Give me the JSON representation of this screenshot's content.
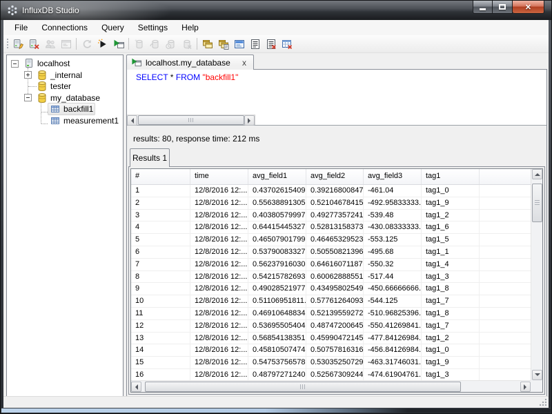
{
  "window": {
    "title": "InfluxDB Studio"
  },
  "menu": {
    "items": [
      "File",
      "Connections",
      "Query",
      "Settings",
      "Help"
    ]
  },
  "toolbar": {
    "buttons": [
      {
        "icon": "connection-edit-icon",
        "enabled": true
      },
      {
        "icon": "connection-delete-icon",
        "enabled": true
      },
      {
        "icon": "users-icon",
        "enabled": false
      },
      {
        "icon": "connection-console-icon",
        "enabled": false
      },
      {
        "sep": true
      },
      {
        "icon": "refresh-icon",
        "enabled": false
      },
      {
        "icon": "run-query-icon",
        "enabled": true
      },
      {
        "icon": "run-query-new-tab-icon",
        "enabled": true
      },
      {
        "sep": true
      },
      {
        "icon": "database-add-icon",
        "enabled": false
      },
      {
        "icon": "database-refresh-icon",
        "enabled": false
      },
      {
        "icon": "database-time-icon",
        "enabled": false
      },
      {
        "icon": "database-delete-icon",
        "enabled": false
      },
      {
        "sep": true
      },
      {
        "icon": "cascade-windows-icon",
        "enabled": true
      },
      {
        "icon": "window-query-icon",
        "enabled": true
      },
      {
        "icon": "console-icon",
        "enabled": true
      },
      {
        "icon": "list-icon",
        "enabled": true
      },
      {
        "icon": "list-delete-icon",
        "enabled": true
      },
      {
        "icon": "table-delete-icon",
        "enabled": true
      }
    ]
  },
  "tree": {
    "items": [
      {
        "label": "localhost",
        "icon": "server",
        "level": 0,
        "expander": "minus"
      },
      {
        "label": "_internal",
        "icon": "database",
        "level": 1,
        "expander": "plus"
      },
      {
        "label": "tester",
        "icon": "database",
        "level": 1,
        "expander": "none"
      },
      {
        "label": "my_database",
        "icon": "database",
        "level": 1,
        "expander": "minus"
      },
      {
        "label": "backfill1",
        "icon": "measurement",
        "level": 2,
        "expander": "none",
        "selected": true
      },
      {
        "label": "measurement1",
        "icon": "measurement",
        "level": 2,
        "expander": "none"
      }
    ]
  },
  "query_tab": {
    "label": "localhost.my_database",
    "close": "x"
  },
  "query": {
    "tokens": [
      {
        "text": "SELECT",
        "type": "keyword"
      },
      {
        "text": " * ",
        "type": "plain"
      },
      {
        "text": "FROM",
        "type": "keyword"
      },
      {
        "text": " ",
        "type": "plain"
      },
      {
        "text": "\"backfill1\"",
        "type": "string"
      }
    ]
  },
  "colors": {
    "keyword": "#0000ff",
    "string": "#ff0000",
    "plain": "#000000"
  },
  "results": {
    "summary": "results: 80, response time: 212 ms",
    "tab_label": "Results 1"
  },
  "table": {
    "columns": [
      "#",
      "time",
      "avg_field1",
      "avg_field2",
      "avg_field3",
      "tag1"
    ],
    "rows": [
      [
        "1",
        "12/8/2016 12:...",
        "0.43702615409...",
        "0.39216800847...",
        "-461.04",
        "tag1_0"
      ],
      [
        "2",
        "12/8/2016 12:...",
        "0.55638891305...",
        "0.52104678415...",
        "-492.95833333...",
        "tag1_9"
      ],
      [
        "3",
        "12/8/2016 12:...",
        "0.40380579997...",
        "0.49277357241...",
        "-539.48",
        "tag1_2"
      ],
      [
        "4",
        "12/8/2016 12:...",
        "0.64415445327...",
        "0.52813158373...",
        "-430.08333333...",
        "tag1_6"
      ],
      [
        "5",
        "12/8/2016 12:...",
        "0.46507901799...",
        "0.46465329523...",
        "-553.125",
        "tag1_5"
      ],
      [
        "6",
        "12/8/2016 12:...",
        "0.53790083327...",
        "0.50550821396...",
        "-495.68",
        "tag1_1"
      ],
      [
        "7",
        "12/8/2016 12:...",
        "0.56237916030...",
        "0.64616071187...",
        "-550.32",
        "tag1_4"
      ],
      [
        "8",
        "12/8/2016 12:...",
        "0.54215782693...",
        "0.60062888551...",
        "-517.44",
        "tag1_3"
      ],
      [
        "9",
        "12/8/2016 12:...",
        "0.49028521977...",
        "0.43495802549...",
        "-450.66666666...",
        "tag1_8"
      ],
      [
        "10",
        "12/8/2016 12:...",
        "0.51106951811...",
        "0.57761264093...",
        "-544.125",
        "tag1_7"
      ],
      [
        "11",
        "12/8/2016 12:...",
        "0.46910648834...",
        "0.52139559272...",
        "-510.96825396...",
        "tag1_8"
      ],
      [
        "12",
        "12/8/2016 12:...",
        "0.53695505404...",
        "0.48747200645...",
        "-550.41269841...",
        "tag1_7"
      ],
      [
        "13",
        "12/8/2016 12:...",
        "0.56854138351...",
        "0.45990472145...",
        "-477.84126984...",
        "tag1_2"
      ],
      [
        "14",
        "12/8/2016 12:...",
        "0.45810507474...",
        "0.50757816316...",
        "-456.84126984...",
        "tag1_0"
      ],
      [
        "15",
        "12/8/2016 12:...",
        "0.54753756578...",
        "0.53035250729...",
        "-463.31746031...",
        "tag1_9"
      ],
      [
        "16",
        "12/8/2016 12:...",
        "0.48797271240...",
        "0.52567309244...",
        "-474.61904761...",
        "tag1_3"
      ]
    ]
  }
}
